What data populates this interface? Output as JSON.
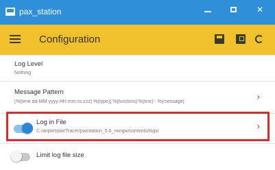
{
  "window": {
    "title": "pax_station",
    "controls": {
      "minimize": "—",
      "maximize": "☐",
      "close": "✕"
    }
  },
  "appbar": {
    "menu_icon": "hamburger-icon",
    "title": "Configuration",
    "actions": [
      "save-icon",
      "save-as-icon",
      "restore-icon"
    ],
    "color": "#f0c12a"
  },
  "settings": {
    "log_level": {
      "label": "Log Level",
      "value": "Nothing"
    },
    "message_pattern": {
      "label": "Message Pattern",
      "value": "[%{time dd-MM-yyyy HH:mm:ss.zzz} %{type}] %{function}:%{line} - %{message}"
    },
    "log_in_file": {
      "label": "Log in File",
      "value": "C:/airport/paxTracer/paxstation_5.6_mingw/contents/logs/",
      "enabled": true
    },
    "limit_log_file_size": {
      "label": "Limit log file size",
      "enabled": false
    }
  },
  "colors": {
    "titlebar": "#2f8fd8",
    "toggle_on": "#2a86d6",
    "highlight_border": "#e02828"
  }
}
